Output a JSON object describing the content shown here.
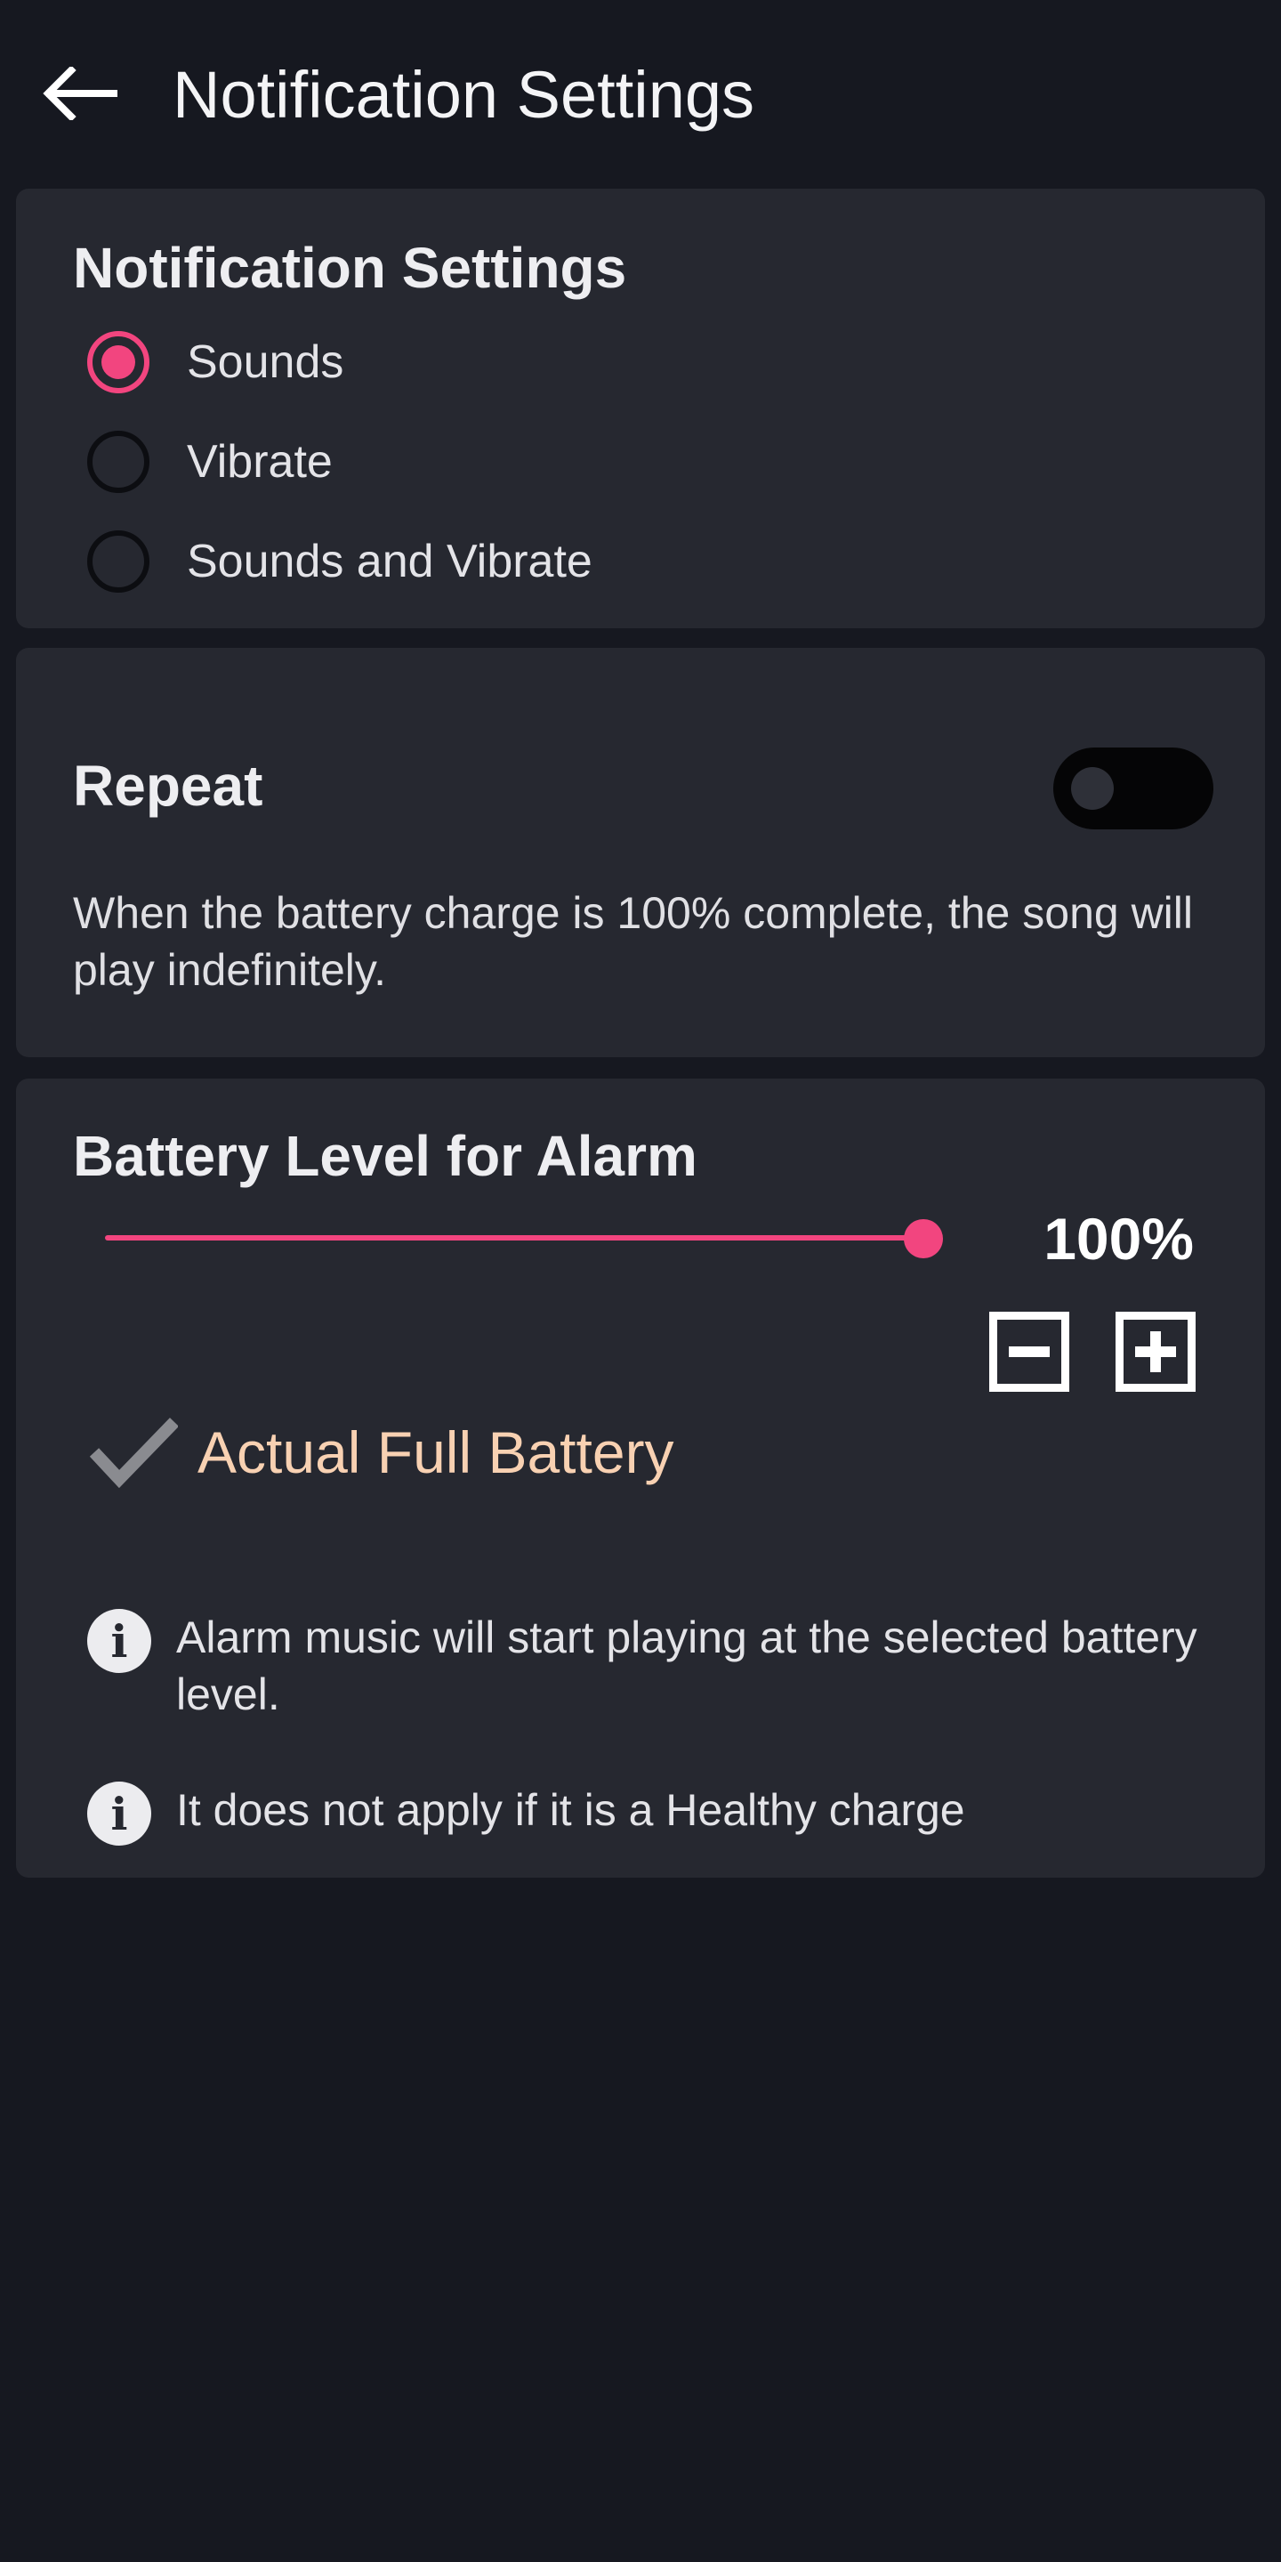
{
  "topbar": {
    "title": "Notification Settings",
    "back_icon": "arrow-left-icon"
  },
  "notification_card": {
    "heading": "Notification Settings",
    "options": [
      {
        "label": "Sounds",
        "checked": true
      },
      {
        "label": "Vibrate",
        "checked": false
      },
      {
        "label": "Sounds and Vibrate",
        "checked": false
      }
    ]
  },
  "repeat_card": {
    "heading": "Repeat",
    "toggle_on": false,
    "description": "When the battery charge is 100% complete, the song will play indefinitely."
  },
  "battery_card": {
    "heading": "Battery Level for Alarm",
    "slider_percent": 100,
    "value_label": "100%",
    "checkbox_label": "Actual Full Battery",
    "checkbox_checked": true,
    "info": [
      "Alarm music will start playing at the selected battery level.",
      "It does not apply if it is a Healthy charge"
    ]
  },
  "colors": {
    "accent": "#f2457f",
    "background": "#161820",
    "card": "#262830",
    "checkbox_label": "#f8d1b2"
  }
}
